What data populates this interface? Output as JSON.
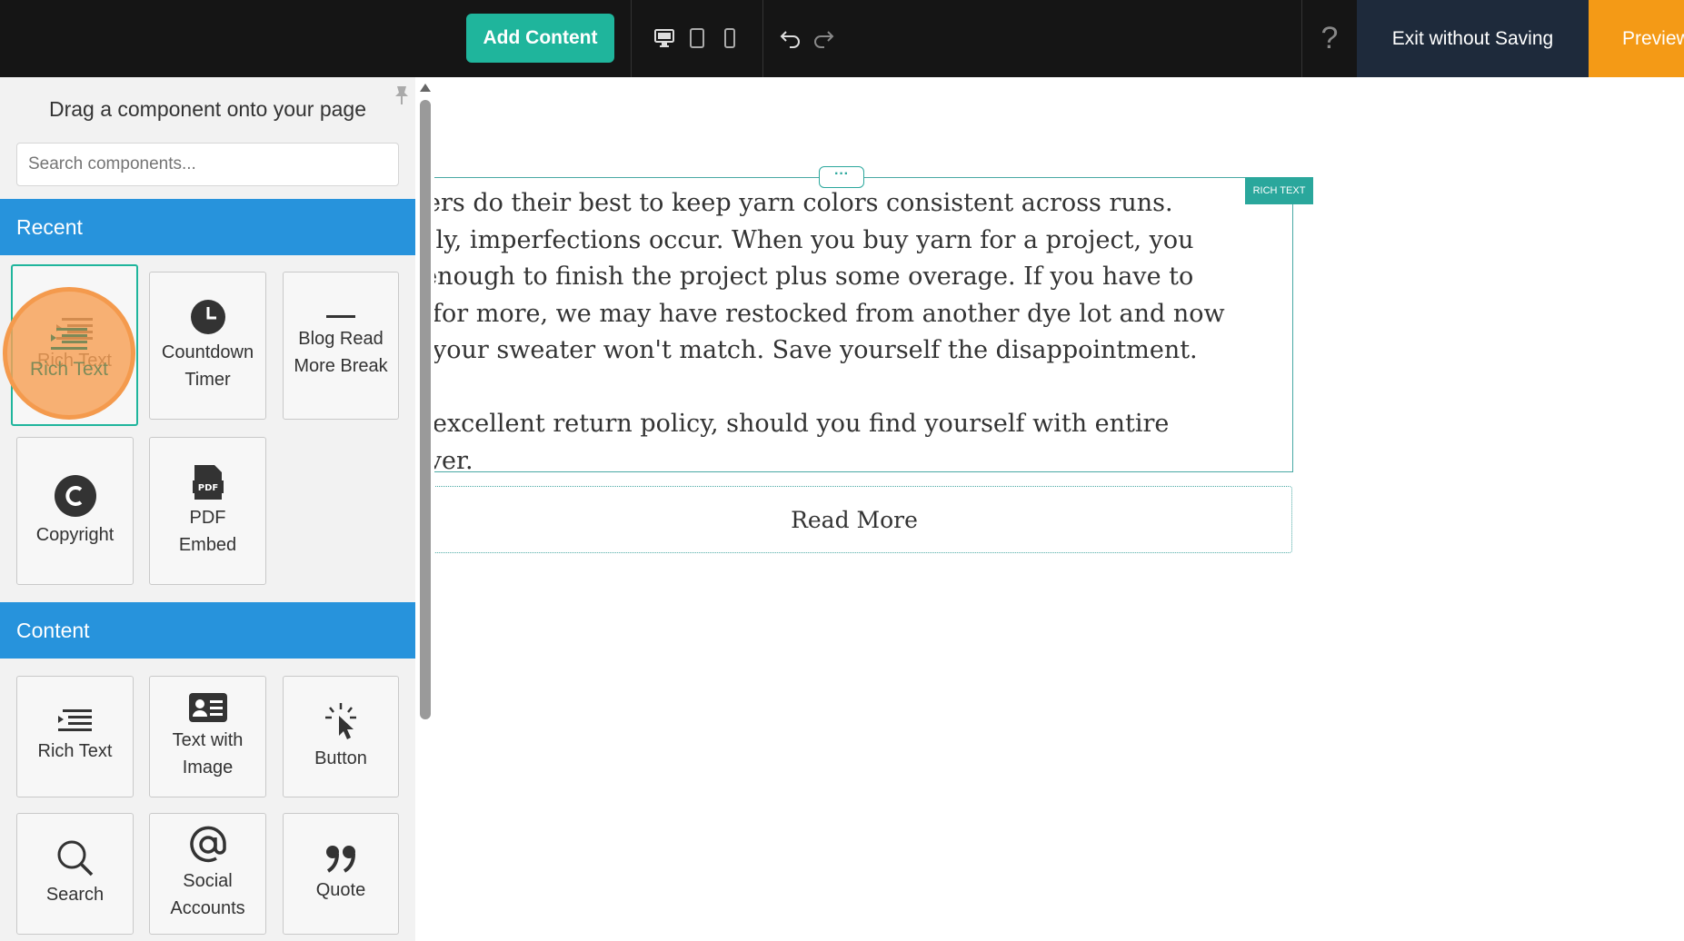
{
  "topbar": {
    "add_content_label": "Add Content",
    "help_label": "?",
    "exit_label": "Exit without Saving",
    "preview_label": "Preview",
    "colors": {
      "bar": "#151515",
      "accent": "#1fb59c",
      "exit": "#1e2a3b",
      "preview": "#f49a16"
    }
  },
  "sidebar": {
    "title": "Drag a component onto your page",
    "search_placeholder": "Search components...",
    "recent_label": "Recent",
    "content_label": "Content",
    "recent": [
      {
        "label": "Rich Text",
        "icon": "rich-text-icon"
      },
      {
        "label": "Countdown Timer",
        "icon": "clock-icon"
      },
      {
        "label": "Blog Read More Break",
        "icon": "dash-icon"
      },
      {
        "label": "Copyright",
        "icon": "copyright-icon"
      },
      {
        "label": "PDF Embed",
        "icon": "pdf-icon"
      }
    ],
    "content": [
      {
        "label": "Rich Text",
        "icon": "rich-text-icon"
      },
      {
        "label": "Text with Image",
        "icon": "id-card-icon"
      },
      {
        "label": "Button",
        "icon": "click-icon"
      },
      {
        "label": "Search",
        "icon": "search-icon"
      },
      {
        "label": "Social Accounts",
        "icon": "at-sign-icon"
      },
      {
        "label": "Quote",
        "icon": "quote-icon"
      }
    ],
    "colors": {
      "section": "#2793dc",
      "highlight": "#f49a4d"
    }
  },
  "canvas": {
    "rich_text_tag": "RICH TEXT",
    "menu_dots": "···",
    "paragraph_lines": [
      "ifacturers do their best to keep yarn colors consistent across runs.",
      "rtunately, imperfections occur. When you buy yarn for a project, you",
      "ld get enough to finish the project plus some overage. If you have to",
      "e back for more, we may have restocked from another dye lot and now",
      "arm of your sweater won't match. Save yourself the disappointment.",
      "",
      "ave an excellent return policy, should you find yourself with entire",
      "is leftover."
    ],
    "read_more_label": "Read More"
  }
}
